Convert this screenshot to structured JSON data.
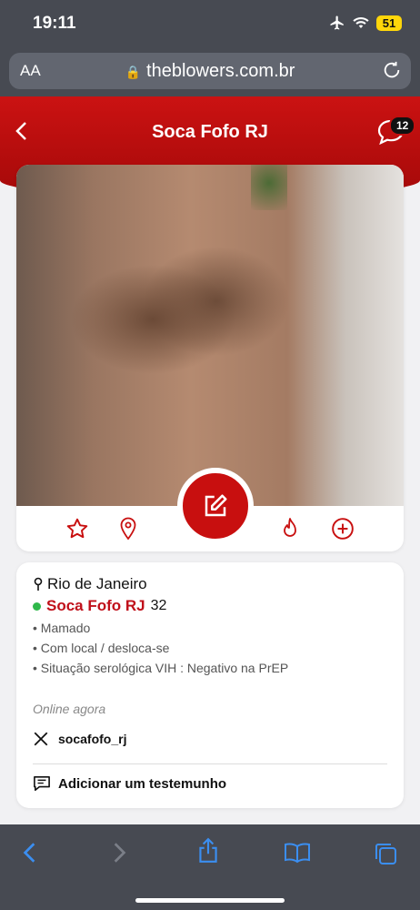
{
  "status": {
    "time": "19:11",
    "battery": "51"
  },
  "browser": {
    "text_size_label": "AA",
    "domain": "theblowers.com.br"
  },
  "header": {
    "title": "Soca Fofo RJ",
    "message_count": "12"
  },
  "profile": {
    "city": "Rio de Janeiro",
    "username": "Soca Fofo RJ",
    "age": "32",
    "details": [
      "• Mamado",
      "• Com local / desloca-se",
      "• Situação serológica VIH : Negativo na PrEP"
    ],
    "online_status": "Online agora",
    "x_handle": "socafofo_rj",
    "add_testimonial": "Adicionar um testemunho"
  },
  "colors": {
    "brand_red": "#c80f0f",
    "ios_blue": "#3b8ef0",
    "online_green": "#2fb84a"
  }
}
